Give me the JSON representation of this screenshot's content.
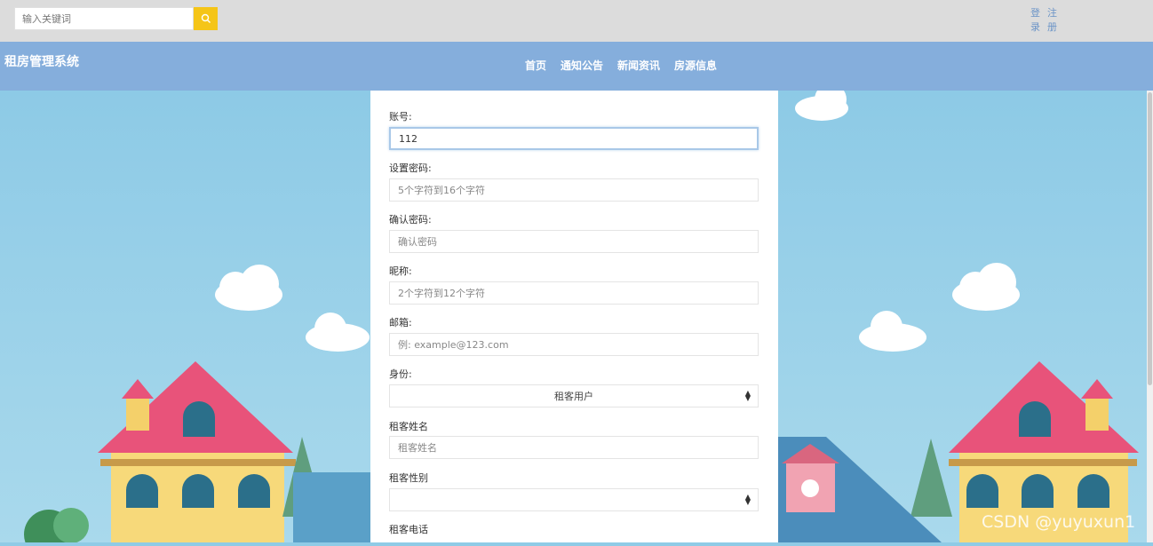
{
  "search": {
    "placeholder": "输入关键词",
    "icon": "search-icon"
  },
  "auth": {
    "login": "登录",
    "register": "注册"
  },
  "nav": {
    "brand": "租房管理系统",
    "items": [
      "首页",
      "通知公告",
      "新闻资讯",
      "房源信息"
    ]
  },
  "form": {
    "account": {
      "label": "账号:",
      "value": "112"
    },
    "password": {
      "label": "设置密码:",
      "placeholder": "5个字符到16个字符"
    },
    "confirm": {
      "label": "确认密码:",
      "placeholder": "确认密码"
    },
    "nickname": {
      "label": "昵称:",
      "placeholder": "2个字符到12个字符"
    },
    "email": {
      "label": "邮箱:",
      "placeholder": "例: example@123.com"
    },
    "identity": {
      "label": "身份:",
      "value": "租客用户"
    },
    "name": {
      "label": "租客姓名",
      "placeholder": "租客姓名"
    },
    "gender": {
      "label": "租客性别",
      "value": ""
    },
    "phone": {
      "label": "租客电话"
    }
  },
  "watermark": "CSDN @yuyuxun1",
  "colors": {
    "topbar": "#dcdcdc",
    "nav": "#85aedc",
    "sky": "#8dcae6",
    "search_button": "#f5c518"
  }
}
